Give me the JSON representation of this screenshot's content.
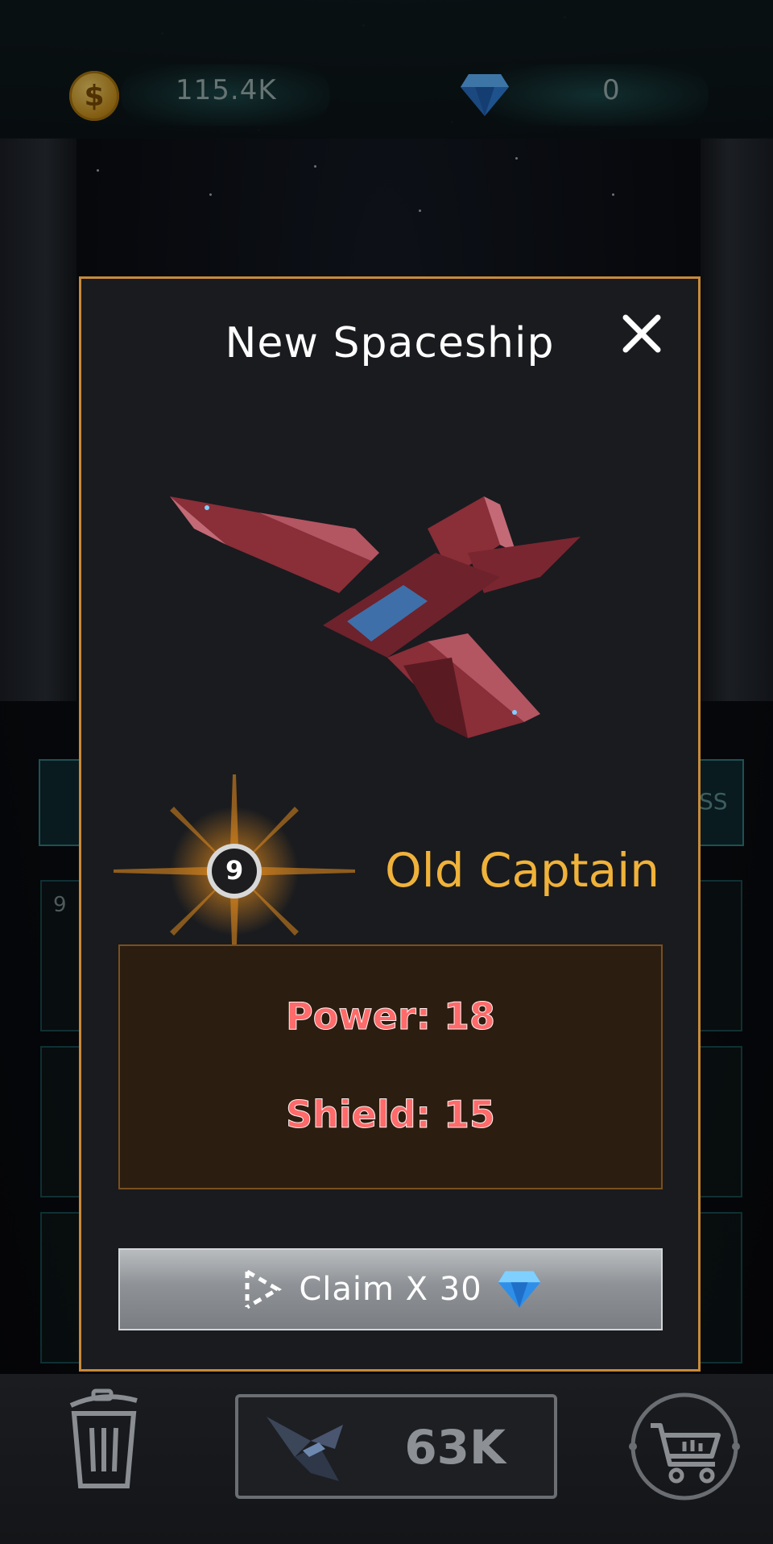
{
  "header": {
    "coins": {
      "value": "115.4K",
      "icon": "dollar-coin-icon"
    },
    "gems": {
      "value": "0",
      "icon": "diamond-gem-icon"
    }
  },
  "modal": {
    "title": "New Spaceship",
    "close_icon": "close-icon",
    "ship": {
      "name": "Old Captain",
      "level": "9",
      "stats": {
        "power": "Power: 18",
        "shield": "Shield: 15"
      }
    },
    "claim_button": {
      "label": "Claim X 30",
      "play_icon": "play-ad-icon",
      "gem_icon": "diamond-gem-icon"
    }
  },
  "background": {
    "slot_level": "9",
    "side_tab_text": "SS"
  },
  "bottom_bar": {
    "trash_icon": "trash-icon",
    "buy_value": "63K",
    "cart_icon": "shopping-cart-icon"
  },
  "colors": {
    "modal_border": "#c88a3a",
    "ship_name": "#f0b23a",
    "stat_text": "#ff6a6a",
    "stats_bg": "#2b1d0f",
    "gem": "#3fa0ff"
  }
}
